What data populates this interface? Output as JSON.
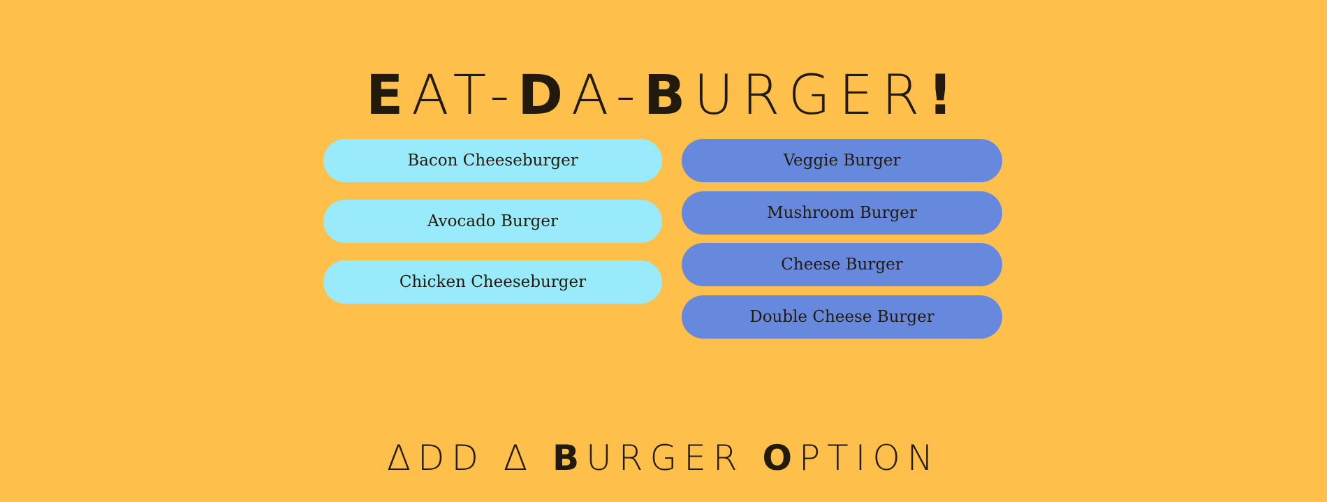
{
  "header": {
    "title_parts": [
      {
        "text": "E",
        "bold": true
      },
      {
        "text": "AT-",
        "bold": false
      },
      {
        "text": "D",
        "bold": true
      },
      {
        "text": "A-",
        "bold": false
      },
      {
        "text": "B",
        "bold": true
      },
      {
        "text": "URGER",
        "bold": false
      },
      {
        "text": "!",
        "bold": true
      }
    ]
  },
  "uneaten_burgers": [
    {
      "name": "Bacon Cheeseburger"
    },
    {
      "name": "Avocado Burger"
    },
    {
      "name": "Chicken Cheeseburger"
    }
  ],
  "eaten_burgers": [
    {
      "name": "Veggie Burger"
    },
    {
      "name": "Mushroom Burger"
    },
    {
      "name": "Cheese Burger"
    },
    {
      "name": "Double Cheese Burger"
    }
  ],
  "add_section": {
    "title_parts": [
      {
        "text": "ΔDD Δ ",
        "bold": false
      },
      {
        "text": "B",
        "bold": true
      },
      {
        "text": "URGER ",
        "bold": false
      },
      {
        "text": "O",
        "bold": true
      },
      {
        "text": "PTION",
        "bold": false
      }
    ]
  },
  "colors": {
    "background": "#FFC04B",
    "uneaten_button": "#99EAFB",
    "eaten_button": "#6789DD",
    "text": "#221a0c"
  }
}
